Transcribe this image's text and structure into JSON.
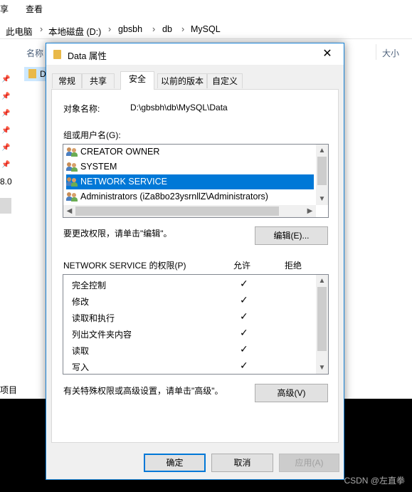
{
  "explorer": {
    "menu": [
      "享",
      "查看"
    ],
    "address": [
      "此电脑",
      "本地磁盘 (D:)",
      "gbsbh",
      "db",
      "MySQL"
    ],
    "name_header": "名称",
    "size_header": "大小",
    "row_peek": "D",
    "left_peek_value": "8.0",
    "left_bottom_text": "项目"
  },
  "dialog": {
    "title": "Data 属性",
    "close": "✕",
    "tabs": [
      "常规",
      "共享",
      "安全",
      "以前的版本",
      "自定义"
    ],
    "active_tab": "安全",
    "object_name_label": "对象名称:",
    "object_name_value": "D:\\gbsbh\\db\\MySQL\\Data",
    "groups_label": "组或用户名(G):",
    "users": [
      "CREATOR OWNER",
      "SYSTEM",
      "NETWORK SERVICE",
      "Administrators (iZa8bo23ysrnllZ\\Administrators)"
    ],
    "selected_user": "NETWORK SERVICE",
    "change_hint": "要更改权限，请单击\"编辑\"。",
    "edit_button": "编辑(E)...",
    "perm_label": "NETWORK SERVICE 的权限(P)",
    "allow_header": "允许",
    "deny_header": "拒绝",
    "permissions": [
      {
        "name": "完全控制",
        "allow": "✓"
      },
      {
        "name": "修改",
        "allow": "✓"
      },
      {
        "name": "读取和执行",
        "allow": "✓"
      },
      {
        "name": "列出文件夹内容",
        "allow": "✓"
      },
      {
        "name": "读取",
        "allow": "✓"
      },
      {
        "name": "写入",
        "allow": "✓"
      }
    ],
    "advanced_hint": "有关特殊权限或高级设置，请单击\"高级\"。",
    "advanced_button": "高级(V)",
    "ok_button": "确定",
    "cancel_button": "取消",
    "apply_button": "应用(A)"
  },
  "watermark": "CSDN @左直拳",
  "colors": {
    "selection": "#0078d7",
    "dialog_border": "#1883d7",
    "folder": "#e9b949"
  }
}
